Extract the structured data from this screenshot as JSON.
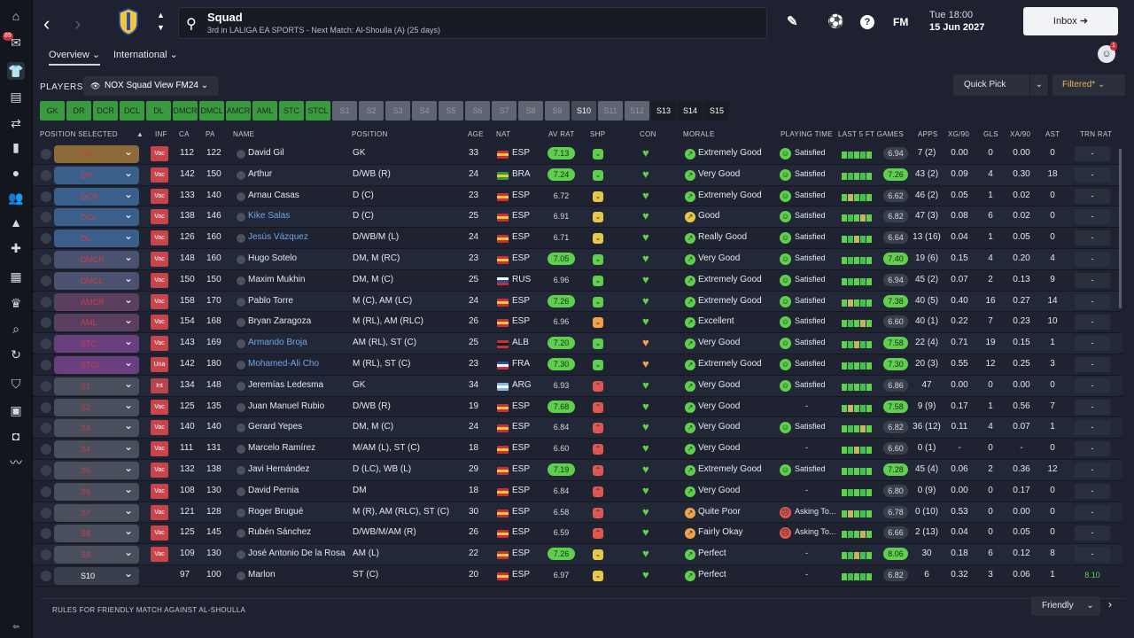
{
  "sidebar": {
    "badge": "89"
  },
  "header": {
    "title": "Squad",
    "subtitle": "3rd in LALIGA EA SPORTS - Next Match: Al-Shoulla (A) (25 days)",
    "date_line1": "Tue 18:00",
    "date_line2": "15 Jun 2027",
    "inbox": "Inbox",
    "fm": "FM",
    "avatar_badge": "1"
  },
  "tabs": [
    "Overview",
    "International"
  ],
  "players_label": "PLAYERS",
  "view": "NOX Squad View FM24",
  "quick_pick": "Quick Pick",
  "filtered": "Filtered*",
  "positions": [
    "GK",
    "DR",
    "DCR",
    "DCL",
    "DL",
    "DMCR",
    "DMCL",
    "AMCR",
    "AML",
    "STC",
    "STCL",
    "S1",
    "S2",
    "S3",
    "S4",
    "S5",
    "S6",
    "S7",
    "S8",
    "S9",
    "S10",
    "S11",
    "S12",
    "S13",
    "S14",
    "S15"
  ],
  "columns": [
    "POSITION SELECTED",
    "INF",
    "CA",
    "PA",
    "NAME",
    "POSITION",
    "AGE",
    "NAT",
    "AV RAT",
    "SHP",
    "CON",
    "MORALE",
    "PLAYING TIME",
    "LAST 5 FT GAMES",
    "APPS",
    "XG/90",
    "GLS",
    "XA/90",
    "AST",
    "TRN RAT"
  ],
  "rows": [
    {
      "sel": "GK",
      "inf": "Vac",
      "ca": "112",
      "pa": "122",
      "name": "David Gil",
      "pos": "GK",
      "age": "33",
      "nat": "ESP",
      "av": "7.13",
      "avg": true,
      "shp": "g",
      "con": "g",
      "mor": "Extremely Good",
      "mc": "g",
      "pt": "Satisfied",
      "frt": "6.94",
      "apps": "7 (2)",
      "xg": "0.00",
      "gls": "0",
      "xa": "0.00",
      "ast": "0",
      "trn": "-"
    },
    {
      "sel": "DR",
      "inf": "Vac",
      "ca": "142",
      "pa": "150",
      "name": "Arthur",
      "pos": "D/WB (R)",
      "age": "24",
      "nat": "BRA",
      "av": "7.24",
      "avg": true,
      "shp": "g",
      "con": "g",
      "mor": "Very Good",
      "mc": "g",
      "pt": "Satisfied",
      "frt": "7.26",
      "frg": true,
      "apps": "43 (2)",
      "xg": "0.09",
      "gls": "4",
      "xa": "0.30",
      "ast": "18",
      "trn": "-"
    },
    {
      "sel": "DCR",
      "inf": "Vac",
      "ca": "133",
      "pa": "140",
      "name": "Arnau Casas",
      "pos": "D (C)",
      "age": "23",
      "nat": "ESP",
      "av": "6.72",
      "shp": "y",
      "con": "g",
      "mor": "Extremely Good",
      "mc": "g",
      "pt": "Satisfied",
      "frt": "6.62",
      "apps": "46 (2)",
      "xg": "0.05",
      "gls": "1",
      "xa": "0.02",
      "ast": "0",
      "trn": "-"
    },
    {
      "sel": "DCL",
      "inf": "Vac",
      "ca": "138",
      "pa": "146",
      "name": "Kike Salas",
      "blue": true,
      "pos": "D (C)",
      "age": "25",
      "nat": "ESP",
      "av": "6.91",
      "shp": "y",
      "con": "g",
      "mor": "Good",
      "mc": "y",
      "pt": "Satisfied",
      "frt": "6.82",
      "apps": "47 (3)",
      "xg": "0.08",
      "gls": "6",
      "xa": "0.02",
      "ast": "0",
      "trn": "-"
    },
    {
      "sel": "DL",
      "inf": "Vac",
      "ca": "126",
      "pa": "160",
      "name": "Jesús Vázquez",
      "blue": true,
      "pos": "D/WB/M (L)",
      "age": "24",
      "nat": "ESP",
      "av": "6.71",
      "shp": "y",
      "con": "g",
      "mor": "Really Good",
      "mc": "g",
      "pt": "Satisfied",
      "frt": "6.64",
      "apps": "13 (16)",
      "xg": "0.04",
      "gls": "1",
      "xa": "0.05",
      "ast": "0",
      "trn": "-"
    },
    {
      "sel": "DMCR",
      "inf": "Vac",
      "ca": "148",
      "pa": "160",
      "name": "Hugo Sotelo",
      "pos": "DM, M (RC)",
      "age": "23",
      "nat": "ESP",
      "av": "7.05",
      "avg": true,
      "shp": "g",
      "con": "g",
      "mor": "Very Good",
      "mc": "g",
      "pt": "Satisfied",
      "frt": "7.40",
      "frg": true,
      "apps": "19 (6)",
      "xg": "0.15",
      "gls": "4",
      "xa": "0.20",
      "ast": "4",
      "trn": "-"
    },
    {
      "sel": "DMCL",
      "inf": "Vac",
      "ca": "150",
      "pa": "150",
      "name": "Maxim Mukhin",
      "pos": "DM, M (C)",
      "age": "25",
      "nat": "RUS",
      "av": "6.96",
      "shp": "g",
      "con": "g",
      "mor": "Extremely Good",
      "mc": "g",
      "pt": "Satisfied",
      "frt": "6.94",
      "apps": "45 (2)",
      "xg": "0.07",
      "gls": "2",
      "xa": "0.13",
      "ast": "9",
      "trn": "-"
    },
    {
      "sel": "AMCR",
      "inf": "Vac",
      "ca": "158",
      "pa": "170",
      "name": "Pablo Torre",
      "pos": "M (C), AM (LC)",
      "age": "24",
      "nat": "ESP",
      "av": "7.26",
      "avg": true,
      "shp": "g",
      "con": "g",
      "mor": "Extremely Good",
      "mc": "g",
      "pt": "Satisfied",
      "frt": "7.38",
      "frg": true,
      "apps": "40 (5)",
      "xg": "0.40",
      "gls": "16",
      "xa": "0.27",
      "ast": "14",
      "trn": "-"
    },
    {
      "sel": "AML",
      "inf": "Vac",
      "ca": "154",
      "pa": "168",
      "name": "Bryan Zaragoza",
      "pos": "M (RL), AM (RLC)",
      "age": "26",
      "nat": "ESP",
      "av": "6.96",
      "shp": "o",
      "con": "g",
      "mor": "Excellent",
      "mc": "g",
      "pt": "Satisfied",
      "frt": "6.60",
      "apps": "40 (1)",
      "xg": "0.22",
      "gls": "7",
      "xa": "0.23",
      "ast": "10",
      "trn": "-"
    },
    {
      "sel": "STC",
      "inf": "Vac",
      "ca": "143",
      "pa": "169",
      "name": "Armando Broja",
      "blue": true,
      "pos": "AM (RL), ST (C)",
      "age": "25",
      "nat": "ALB",
      "av": "7.20",
      "avg": true,
      "shp": "g",
      "con": "o",
      "mor": "Very Good",
      "mc": "g",
      "pt": "Satisfied",
      "frt": "7.58",
      "frg": true,
      "apps": "22 (4)",
      "xg": "0.71",
      "gls": "19",
      "xa": "0.15",
      "ast": "1",
      "trn": "-"
    },
    {
      "sel": "STCL",
      "inf": "Una",
      "ca": "142",
      "pa": "180",
      "name": "Mohamed-Ali Cho",
      "blue": true,
      "pos": "M (RL), ST (C)",
      "age": "23",
      "nat": "FRA",
      "av": "7.30",
      "avg": true,
      "shp": "g",
      "con": "o",
      "mor": "Extremely Good",
      "mc": "g",
      "pt": "Satisfied",
      "frt": "7.30",
      "frg": true,
      "apps": "20 (3)",
      "xg": "0.55",
      "gls": "12",
      "xa": "0.25",
      "ast": "3",
      "trn": "-"
    },
    {
      "sel": "S1",
      "inf": "Int",
      "ca": "134",
      "pa": "148",
      "name": "Jeremías Ledesma",
      "pos": "GK",
      "age": "34",
      "nat": "ARG",
      "av": "6.93",
      "shp": "r",
      "con": "g",
      "mor": "Very Good",
      "mc": "g",
      "pt": "Satisfied",
      "frt": "6.86",
      "apps": "47",
      "xg": "0.00",
      "gls": "0",
      "xa": "0.00",
      "ast": "0",
      "trn": "-"
    },
    {
      "sel": "S2",
      "inf": "Vac",
      "ca": "125",
      "pa": "135",
      "name": "Juan Manuel Rubio",
      "pos": "D/WB (R)",
      "age": "19",
      "nat": "ESP",
      "av": "7.68",
      "avg": true,
      "shp": "r",
      "con": "g",
      "mor": "Very Good",
      "mc": "g",
      "pt": "-",
      "frt": "7.58",
      "frg": true,
      "apps": "9 (9)",
      "xg": "0.17",
      "gls": "1",
      "xa": "0.56",
      "ast": "7",
      "trn": "-"
    },
    {
      "sel": "S3",
      "inf": "Vac",
      "ca": "140",
      "pa": "140",
      "name": "Gerard Yepes",
      "pos": "DM, M (C)",
      "age": "24",
      "nat": "ESP",
      "av": "6.84",
      "shp": "r",
      "con": "g",
      "mor": "Very Good",
      "mc": "g",
      "pt": "Satisfied",
      "frt": "6.82",
      "apps": "36 (12)",
      "xg": "0.11",
      "gls": "4",
      "xa": "0.07",
      "ast": "1",
      "trn": "-"
    },
    {
      "sel": "S4",
      "inf": "Vac",
      "ca": "111",
      "pa": "131",
      "name": "Marcelo Ramírez",
      "pos": "M/AM (L), ST (C)",
      "age": "18",
      "nat": "ESP",
      "av": "6.60",
      "shp": "r",
      "con": "g",
      "mor": "Very Good",
      "mc": "g",
      "pt": "-",
      "frt": "6.60",
      "apps": "0 (1)",
      "xg": "-",
      "gls": "0",
      "xa": "-",
      "ast": "0",
      "trn": "-"
    },
    {
      "sel": "S5",
      "inf": "Vac",
      "ca": "132",
      "pa": "138",
      "name": "Javi Hernández",
      "pos": "D (LC), WB (L)",
      "age": "29",
      "nat": "ESP",
      "av": "7.19",
      "avg": true,
      "shp": "r",
      "con": "g",
      "mor": "Extremely Good",
      "mc": "g",
      "pt": "Satisfied",
      "frt": "7.28",
      "frg": true,
      "apps": "45 (4)",
      "xg": "0.06",
      "gls": "2",
      "xa": "0.36",
      "ast": "12",
      "trn": "-"
    },
    {
      "sel": "S6",
      "inf": "Vac",
      "ca": "108",
      "pa": "130",
      "name": "David Pernia",
      "pos": "DM",
      "age": "18",
      "nat": "ESP",
      "av": "6.84",
      "shp": "r",
      "con": "g",
      "mor": "Very Good",
      "mc": "g",
      "pt": "-",
      "frt": "6.80",
      "apps": "0 (9)",
      "xg": "0.00",
      "gls": "0",
      "xa": "0.17",
      "ast": "0",
      "trn": "-"
    },
    {
      "sel": "S7",
      "inf": "Vac",
      "ca": "121",
      "pa": "128",
      "name": "Roger Brugué",
      "pos": "M (R), AM (RLC), ST (C)",
      "age": "30",
      "nat": "ESP",
      "av": "6.58",
      "shp": "r",
      "con": "g",
      "mor": "Quite Poor",
      "mc": "o",
      "pt": "Asking To...",
      "ptr": true,
      "frt": "6.78",
      "apps": "0 (10)",
      "xg": "0.53",
      "gls": "0",
      "xa": "0.00",
      "ast": "0",
      "trn": "-"
    },
    {
      "sel": "S8",
      "inf": "Vac",
      "ca": "125",
      "pa": "145",
      "name": "Rubén Sánchez",
      "pos": "D/WB/M/AM (R)",
      "age": "26",
      "nat": "ESP",
      "av": "6.59",
      "shp": "r",
      "con": "g",
      "mor": "Fairly Okay",
      "mc": "o",
      "pt": "Asking To...",
      "ptr": true,
      "frt": "6.66",
      "apps": "2 (13)",
      "xg": "0.04",
      "gls": "0",
      "xa": "0.05",
      "ast": "0",
      "trn": "-"
    },
    {
      "sel": "S9",
      "inf": "Vac",
      "ca": "109",
      "pa": "130",
      "name": "José Antonio De la Rosa",
      "pos": "AM (L)",
      "age": "22",
      "nat": "ESP",
      "av": "7.26",
      "avg": true,
      "shp": "y",
      "con": "g",
      "mor": "Perfect",
      "mc": "g",
      "pt": "-",
      "frt": "8.06",
      "frg": true,
      "apps": "30",
      "xg": "0.18",
      "gls": "6",
      "xa": "0.12",
      "ast": "8",
      "trn": "-"
    },
    {
      "sel": "S10",
      "last": true,
      "inf": "",
      "ca": "97",
      "pa": "100",
      "name": "Marlon",
      "pos": "ST (C)",
      "age": "20",
      "nat": "ESP",
      "av": "6.97",
      "shp": "y",
      "con": "g",
      "mor": "Perfect",
      "mc": "g",
      "pt": "-",
      "frt": "6.82",
      "apps": "6",
      "xg": "0.32",
      "gls": "3",
      "xa": "0.06",
      "ast": "1",
      "trn": "8.10"
    }
  ],
  "footer": {
    "rules": "RULES FOR FRIENDLY MATCH AGAINST AL-SHOULLA",
    "friendly": "Friendly"
  },
  "colors": {
    "green": "#5fcf4d",
    "yellow": "#e6c84a",
    "orange": "#f0a24a",
    "red": "#e0574f",
    "accent": "#e6b25c"
  }
}
